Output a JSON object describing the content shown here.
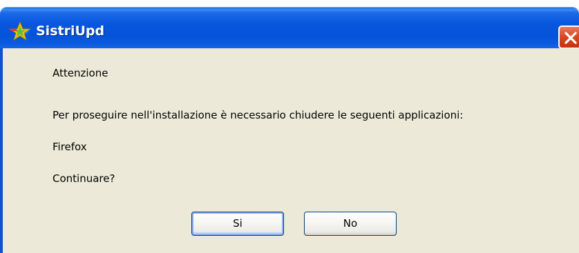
{
  "window": {
    "title": "SistriUpd",
    "close_icon": "close-icon",
    "app_icon": "star-icon"
  },
  "message": {
    "heading": "Attenzione",
    "body": "Per proseguire nell'installazione è necessario chiudere le seguenti applicazioni:",
    "app_list": "Firefox",
    "question": "Continuare?"
  },
  "buttons": {
    "yes_label": "Si",
    "no_label": "No"
  },
  "colors": {
    "titlebar": "#0757de",
    "client_bg": "#ece9d8",
    "close_button": "#d8461f",
    "button_border": "#003c74"
  }
}
